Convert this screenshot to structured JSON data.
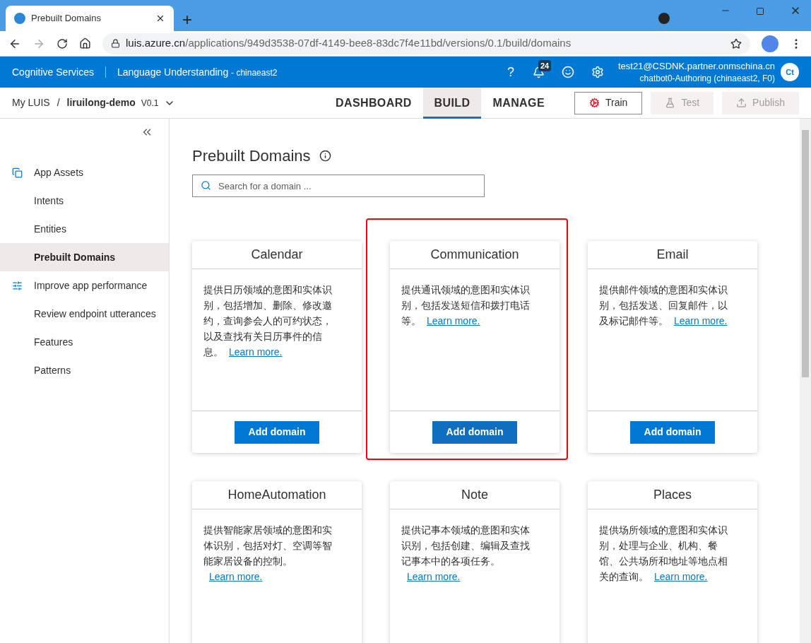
{
  "browser": {
    "tab_title": "Prebuilt Domains",
    "new_tab": "+",
    "url_host": "luis.azure.cn",
    "url_path": "/applications/949d3538-07df-4149-bee8-83dc7f4e11bd/versions/0.1/build/domains"
  },
  "header": {
    "brand": "Cognitive Services",
    "service": "Language Understanding",
    "region": "- chinaeast2",
    "help": "?",
    "notifications": "24",
    "user": "test21@CSDNK.partner.onmschina.cn",
    "subscription": "chatbot0-Authoring (chinaeast2, F0)",
    "avatar": "Ct"
  },
  "nav": {
    "breadcrumb_root": "My LUIS",
    "separator": "/",
    "app": "liruilong-demo",
    "version": "V0.1",
    "tabs": [
      {
        "label": "DASHBOARD",
        "selected": false
      },
      {
        "label": "BUILD",
        "selected": true
      },
      {
        "label": "MANAGE",
        "selected": false
      }
    ],
    "actions": [
      {
        "kind": "train",
        "label": "Train",
        "disabled": false
      },
      {
        "kind": "test",
        "label": "Test",
        "disabled": true
      },
      {
        "kind": "publish",
        "label": "Publish",
        "disabled": true
      }
    ]
  },
  "sidebar": {
    "items": [
      {
        "kind": "assets",
        "label": "App Assets",
        "selected": false
      },
      {
        "kind": "sub",
        "label": "Intents",
        "selected": false
      },
      {
        "kind": "sub",
        "label": "Entities",
        "selected": false
      },
      {
        "kind": "sub",
        "label": "Prebuilt Domains",
        "selected": true
      },
      {
        "kind": "performance",
        "label": "Improve app performance",
        "selected": false
      },
      {
        "kind": "sub",
        "label": "Review endpoint utterances",
        "selected": false
      },
      {
        "kind": "sub",
        "label": "Features",
        "selected": false
      },
      {
        "kind": "sub",
        "label": "Patterns",
        "selected": false
      }
    ]
  },
  "page": {
    "title": "Prebuilt Domains",
    "search": {
      "placeholder": "Search for a domain ..."
    },
    "domains": [
      {
        "name": "Calendar",
        "description": "提供日历领域的意图和实体识别，包括增加、删除、修改邀约，查询参会人的可约状态，以及查找有关日历事件的信息。",
        "link": "Learn more.",
        "button": "Add domain",
        "highlighted": false
      },
      {
        "name": "Communication",
        "description": "提供通讯领域的意图和实体识别，包括发送短信和拨打电话等。",
        "link": "Learn more.",
        "button": "Add domain",
        "highlighted": true
      },
      {
        "name": "Email",
        "description": "提供邮件领域的意图和实体识别，包括发送、回复邮件，以及标记邮件等。",
        "link": "Learn more.",
        "button": "Add domain",
        "highlighted": false
      },
      {
        "name": "HomeAutomation",
        "description": "提供智能家居领域的意图和实体识别，包括对灯、空调等智能家居设备的控制。",
        "link": "Learn more.",
        "highlighted": false
      },
      {
        "name": "Note",
        "description": "提供记事本领域的意图和实体识别，包括创建、编辑及查找记事本中的各项任务。",
        "link": "Learn more.",
        "highlighted": false
      },
      {
        "name": "Places",
        "description": "提供场所领域的意图和实体识别，处理与企业、机构、餐馆、公共场所和地址等地点相关的查询。",
        "link": "Learn more.",
        "highlighted": false
      }
    ]
  }
}
